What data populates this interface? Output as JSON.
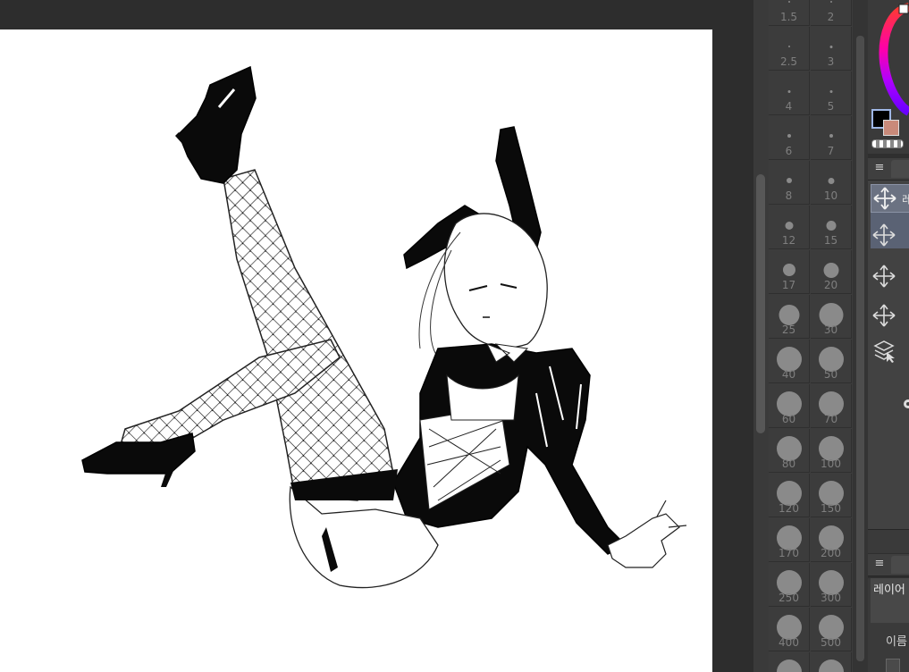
{
  "brush_sizes": [
    {
      "label": "1.5",
      "dot": 2
    },
    {
      "label": "2",
      "dot": 2
    },
    {
      "label": "2.5",
      "dot": 2
    },
    {
      "label": "3",
      "dot": 3
    },
    {
      "label": "4",
      "dot": 3
    },
    {
      "label": "5",
      "dot": 3
    },
    {
      "label": "6",
      "dot": 4
    },
    {
      "label": "7",
      "dot": 4
    },
    {
      "label": "8",
      "dot": 6
    },
    {
      "label": "10",
      "dot": 7
    },
    {
      "label": "12",
      "dot": 9
    },
    {
      "label": "15",
      "dot": 11
    },
    {
      "label": "17",
      "dot": 14
    },
    {
      "label": "20",
      "dot": 17
    },
    {
      "label": "25",
      "dot": 23
    },
    {
      "label": "30",
      "dot": 27
    },
    {
      "label": "40",
      "dot": 28
    },
    {
      "label": "50",
      "dot": 28
    },
    {
      "label": "60",
      "dot": 28
    },
    {
      "label": "70",
      "dot": 28
    },
    {
      "label": "80",
      "dot": 28
    },
    {
      "label": "100",
      "dot": 28
    },
    {
      "label": "120",
      "dot": 28
    },
    {
      "label": "150",
      "dot": 28
    },
    {
      "label": "170",
      "dot": 28
    },
    {
      "label": "200",
      "dot": 28
    },
    {
      "label": "250",
      "dot": 28
    },
    {
      "label": "300",
      "dot": 28
    },
    {
      "label": "400",
      "dot": 28
    },
    {
      "label": "500",
      "dot": 28
    },
    {
      "label": "",
      "dot": 28
    },
    {
      "label": "",
      "dot": 28
    }
  ],
  "tool_panel": {
    "first_item_label": "레이",
    "menu_icon": "≡"
  },
  "layer_panel": {
    "menu_icon": "≡",
    "layer_name_value": "레이어",
    "name_label": "이름"
  },
  "colors": {
    "main_color": "#000000",
    "sub_color": "#c98a7a",
    "canvas": "#ffffff",
    "ui_dark": "#2d2d2d",
    "accent": "#8b93a6"
  }
}
